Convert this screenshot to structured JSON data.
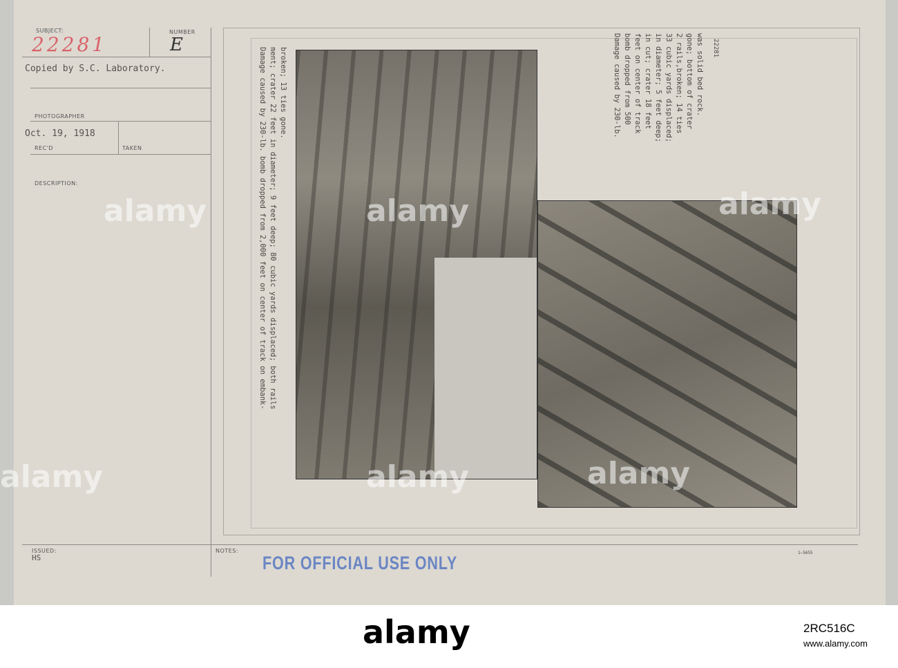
{
  "card": {
    "subject_label": "SUBJECT:",
    "subject_value": "22281",
    "number_label": "NUMBER",
    "number_value": "E",
    "copied_by": "Copied by S.C. Laboratory.",
    "photographer_label": "PHOTOGRAPHER",
    "recd_date": "Oct. 19, 1918",
    "recd_label": "REC'D",
    "taken_label": "TAKEN",
    "description_label": "DESCRIPTION:",
    "issued_label": "ISSUED:",
    "issued_value": "HS",
    "notes_label": "NOTES:",
    "stamp": "FOR OFFICIAL USE ONLY",
    "form_number": "1—5655",
    "photo_number": "22281"
  },
  "captions": {
    "left_photo": "Damage caused by 230-lb. bomb dropped from 2,000 feet on center of track on embank-\nment; crater 22 feet in diameter; 9 feet deep; 80 cubic yards displaced; both rails\nbroken; 13 ties gone.",
    "right_photo": "Damage caused by 230-lb.\nbomb dropped from 500\nfeet on center of track\nin cut; crater 18 feet\nin diameter; 5 feet deep;\n33 cubic yards displaced;\n2 rails,broken; 14 ties\ngone; bottom of crater\nwas solid bed rock."
  },
  "watermark": "alamy",
  "footer": {
    "logo": "alamy",
    "image_id": "2RC516C",
    "url": "www.alamy.com"
  }
}
